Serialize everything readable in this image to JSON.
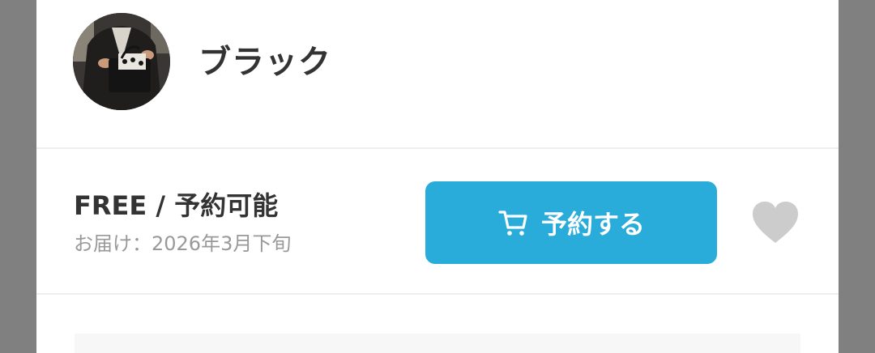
{
  "variant": {
    "color_name": "ブラック"
  },
  "purchase": {
    "size_status": "FREE / 予約可能",
    "delivery": "お届け：2026年3月下旬",
    "reserve_button_label": "予約する"
  },
  "colors": {
    "button": "#29acd9",
    "heart": "#cccccc",
    "text_primary": "#333333",
    "text_secondary": "#999999"
  },
  "icons": {
    "cart": "cart-icon",
    "favorite": "heart-icon"
  }
}
